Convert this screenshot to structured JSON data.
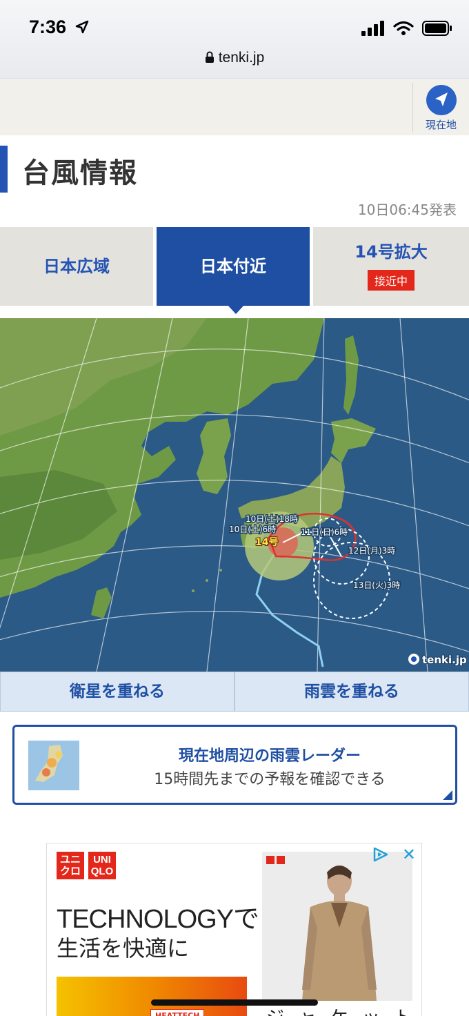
{
  "status": {
    "time": "7:36",
    "url": "tenki.jp"
  },
  "appbar": {
    "current_location": "現在地"
  },
  "page": {
    "title": "台風情報",
    "issued": "10日06:45発表"
  },
  "tabs": [
    {
      "label": "日本広域"
    },
    {
      "label": "日本付近",
      "active": true
    },
    {
      "label": "14号拡大",
      "badge": "接近中"
    }
  ],
  "map": {
    "watermark": "tenki.jp",
    "typhoon_number": "14号",
    "labels": [
      "10日(土)18時",
      "10日(土)6時",
      "11日(日)6時",
      "12日(月)3時",
      "13日(火)3時"
    ],
    "colors": {
      "sea": "#2c5a86",
      "land": "#6f9a45",
      "storm_area": "#b5c97a",
      "warning": "#e03030"
    }
  },
  "overlays": {
    "satellite": "衛星を重ねる",
    "rain": "雨雲を重ねる"
  },
  "radar_card": {
    "title": "現在地周辺の雨雲レーダー",
    "subtitle": "15時間先までの予報を確認できる"
  },
  "ad": {
    "logo_left": [
      "ユニ",
      "クロ"
    ],
    "logo_right": [
      "UNI",
      "QLO"
    ],
    "headline": "TECHNOLOGYで",
    "subline": "生活を快適に",
    "tag": "HEATTECH",
    "bottom_text": "ジ ャ ケ ッ ト"
  }
}
